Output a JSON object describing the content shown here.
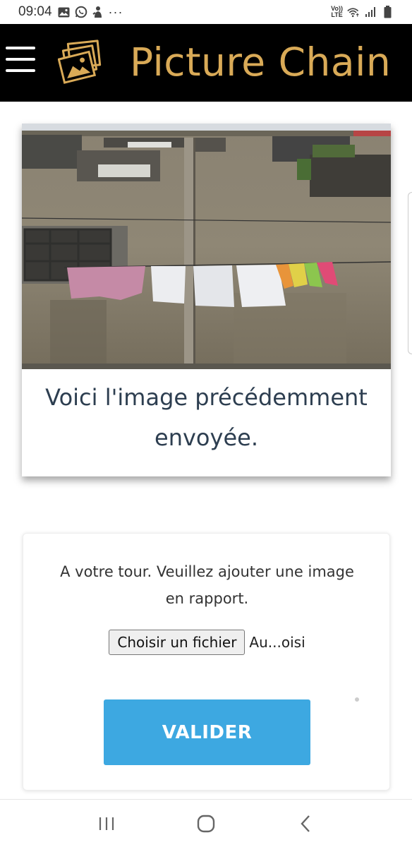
{
  "status_bar": {
    "time": "09:04",
    "more_dots": "···",
    "volte_top": "Vo))",
    "volte_bottom": "LTE"
  },
  "header": {
    "title": "Picture Chain",
    "title_color": "#d9aa57",
    "background": "#000000"
  },
  "previous_image": {
    "caption": "Voici l'image précédemment envoyée."
  },
  "form": {
    "prompt": "A votre tour. Veuillez ajouter une image en rapport.",
    "file_button_label": "Choisir un fichier",
    "file_name": "Au...oisi",
    "submit_label": "VALIDER",
    "submit_color": "#3da8e1"
  },
  "icons": {
    "status": [
      "image-icon",
      "whatsapp-icon",
      "notification-icon",
      "wifi-icon",
      "signal-icon",
      "battery-icon"
    ],
    "nav": [
      "recent-apps-icon",
      "home-icon",
      "back-icon"
    ]
  }
}
